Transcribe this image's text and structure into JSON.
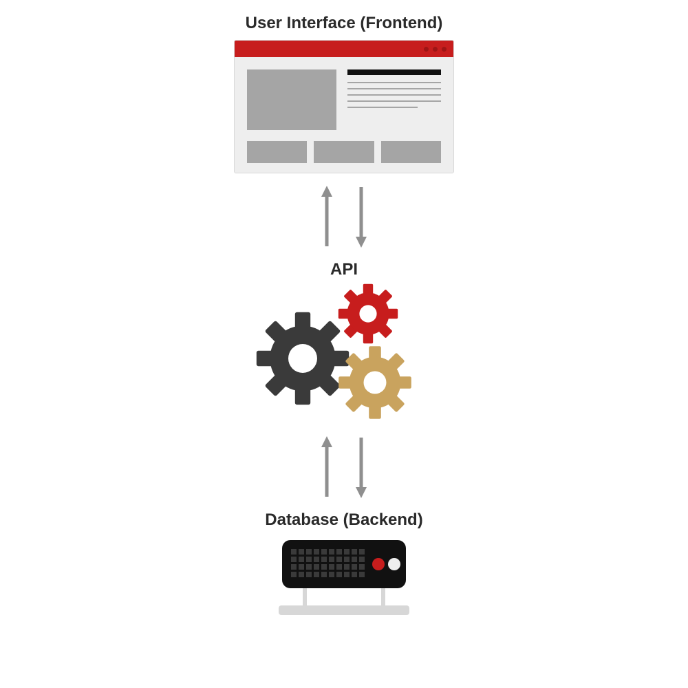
{
  "labels": {
    "frontend": "User Interface (Frontend)",
    "api": "API",
    "backend": "Database (Backend)"
  },
  "colors": {
    "red": "#c71d1d",
    "darkred": "#9e1515",
    "grey": "#a5a5a5",
    "darkgrey": "#3a3a3a",
    "gold": "#c9a35e",
    "arrow": "#8f8f8f"
  }
}
